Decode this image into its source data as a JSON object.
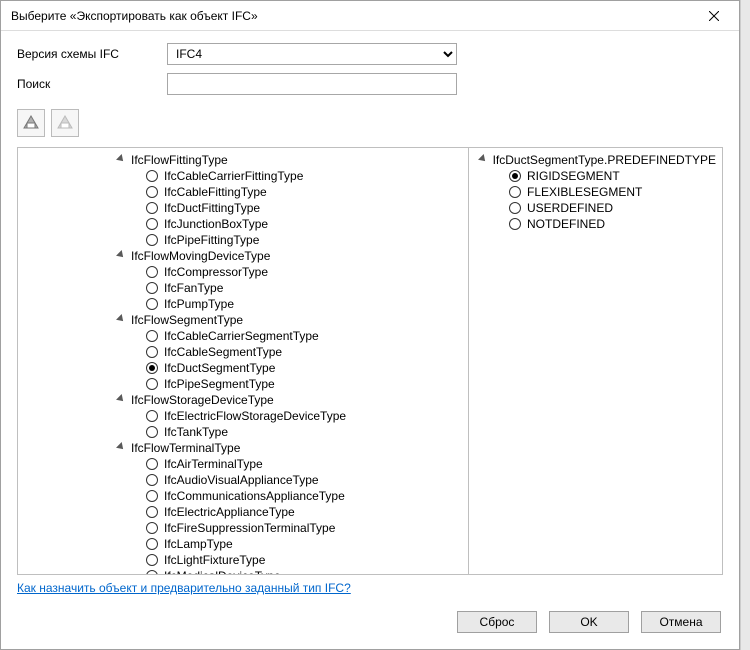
{
  "window": {
    "title": "Выберите «Экспортировать как объект IFC»"
  },
  "form": {
    "version_label": "Версия схемы IFC",
    "version_value": "IFC4",
    "search_label": "Поиск",
    "search_value": ""
  },
  "left_tree": {
    "groups": [
      {
        "label": "IfcFlowFittingType",
        "children": [
          {
            "label": "IfcCableCarrierFittingType",
            "selected": false
          },
          {
            "label": "IfcCableFittingType",
            "selected": false
          },
          {
            "label": "IfcDuctFittingType",
            "selected": false
          },
          {
            "label": "IfcJunctionBoxType",
            "selected": false
          },
          {
            "label": "IfcPipeFittingType",
            "selected": false
          }
        ]
      },
      {
        "label": "IfcFlowMovingDeviceType",
        "children": [
          {
            "label": "IfcCompressorType",
            "selected": false
          },
          {
            "label": "IfcFanType",
            "selected": false
          },
          {
            "label": "IfcPumpType",
            "selected": false
          }
        ]
      },
      {
        "label": "IfcFlowSegmentType",
        "children": [
          {
            "label": "IfcCableCarrierSegmentType",
            "selected": false
          },
          {
            "label": "IfcCableSegmentType",
            "selected": false
          },
          {
            "label": "IfcDuctSegmentType",
            "selected": true
          },
          {
            "label": "IfcPipeSegmentType",
            "selected": false
          }
        ]
      },
      {
        "label": "IfcFlowStorageDeviceType",
        "children": [
          {
            "label": "IfcElectricFlowStorageDeviceType",
            "selected": false
          },
          {
            "label": "IfcTankType",
            "selected": false
          }
        ]
      },
      {
        "label": "IfcFlowTerminalType",
        "children": [
          {
            "label": "IfcAirTerminalType",
            "selected": false
          },
          {
            "label": "IfcAudioVisualApplianceType",
            "selected": false
          },
          {
            "label": "IfcCommunicationsApplianceType",
            "selected": false
          },
          {
            "label": "IfcElectricApplianceType",
            "selected": false
          },
          {
            "label": "IfcFireSuppressionTerminalType",
            "selected": false
          },
          {
            "label": "IfcLampType",
            "selected": false
          },
          {
            "label": "IfcLightFixtureType",
            "selected": false
          },
          {
            "label": "IfcMedicalDeviceType",
            "selected": false
          }
        ]
      }
    ]
  },
  "right_tree": {
    "header": "IfcDuctSegmentType.PREDEFINEDTYPE",
    "items": [
      {
        "label": "RIGIDSEGMENT",
        "selected": true
      },
      {
        "label": "FLEXIBLESEGMENT",
        "selected": false
      },
      {
        "label": "USERDEFINED",
        "selected": false
      },
      {
        "label": "NOTDEFINED",
        "selected": false
      }
    ]
  },
  "footer": {
    "link": "Как назначить объект и предварительно заданный тип IFC?",
    "reset": "Сброс",
    "ok": "OK",
    "cancel": "Отмена"
  }
}
